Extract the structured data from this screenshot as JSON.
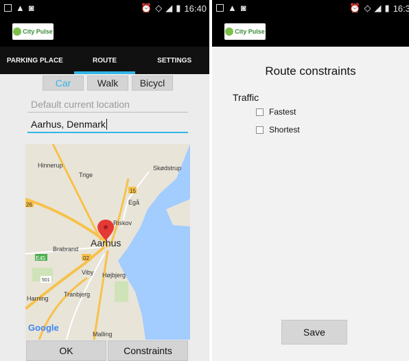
{
  "left_screen": {
    "status": {
      "time": "16:40"
    },
    "app_logo": "City Pulse",
    "tabs": [
      {
        "label": "PARKING PLACE",
        "active": false
      },
      {
        "label": "ROUTE",
        "active": true
      },
      {
        "label": "SETTINGS",
        "active": false
      }
    ],
    "modes": [
      {
        "label": "Car",
        "selected": true
      },
      {
        "label": "Walk",
        "selected": false
      },
      {
        "label": "Bicycl",
        "selected": false
      }
    ],
    "start_field": {
      "placeholder": "Default current location",
      "value": ""
    },
    "destination_field": {
      "value": "Aarhus, Denmark"
    },
    "map": {
      "city_label": "Aarhus",
      "place_labels": [
        "Hinnerup",
        "Trige",
        "Skødstrup",
        "Egå",
        "Riskov",
        "Brabrand",
        "Viby",
        "Højbjerg",
        "Tranbjerg",
        "Harning",
        "Malling",
        "Google"
      ],
      "road_labels": [
        "26",
        "15",
        "E45",
        "02",
        "501"
      ]
    },
    "buttons": {
      "ok": "OK",
      "constraints": "Constraints"
    }
  },
  "right_screen": {
    "status": {
      "time": "16:3"
    },
    "app_logo": "City Pulse",
    "title": "Route constraints",
    "section_label": "Traffic",
    "options": [
      {
        "label": "Fastest",
        "checked": false
      },
      {
        "label": "Shortest",
        "checked": false
      }
    ],
    "save_label": "Save"
  },
  "colors": {
    "accent": "#33b5e5",
    "selected_mode_text": "#33b5e5",
    "map_water": "#a3ccff",
    "map_land": "#e8e4d8",
    "road_major": "#f7c14a",
    "map_pin": "#e53935"
  }
}
